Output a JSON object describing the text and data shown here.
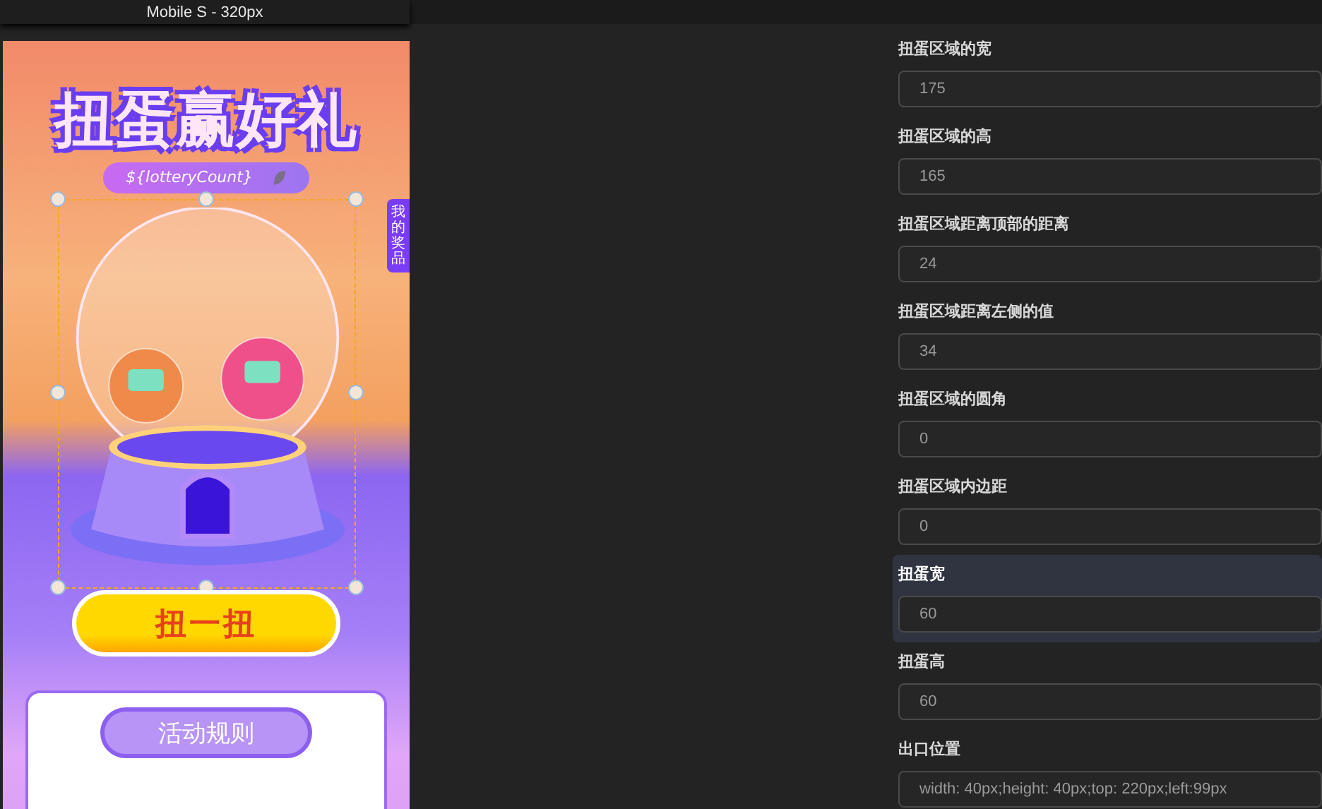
{
  "device_tab": {
    "label": "Mobile S - 320px"
  },
  "preview": {
    "title": "扭蛋赢好礼",
    "count_pill": "${lotteryCount}",
    "side_tab": "我的奖品",
    "spin_button": "扭一扭",
    "rules_button": "活动规则",
    "selection_active": true
  },
  "settings": [
    {
      "label": "扭蛋区域的宽",
      "value": "175",
      "selected": false
    },
    {
      "label": "扭蛋区域的高",
      "value": "165",
      "selected": false
    },
    {
      "label": "扭蛋区域距离顶部的距离",
      "value": "24",
      "selected": false
    },
    {
      "label": "扭蛋区域距离左侧的值",
      "value": "34",
      "selected": false
    },
    {
      "label": "扭蛋区域的圆角",
      "value": "0",
      "selected": false
    },
    {
      "label": "扭蛋区域内边距",
      "value": "0",
      "selected": false
    },
    {
      "label": "扭蛋宽",
      "value": "60",
      "selected": true
    },
    {
      "label": "扭蛋高",
      "value": "60",
      "selected": false
    },
    {
      "label": "出口位置",
      "value": "width: 40px;height: 40px;top: 220px;left:99px",
      "selected": false
    }
  ]
}
